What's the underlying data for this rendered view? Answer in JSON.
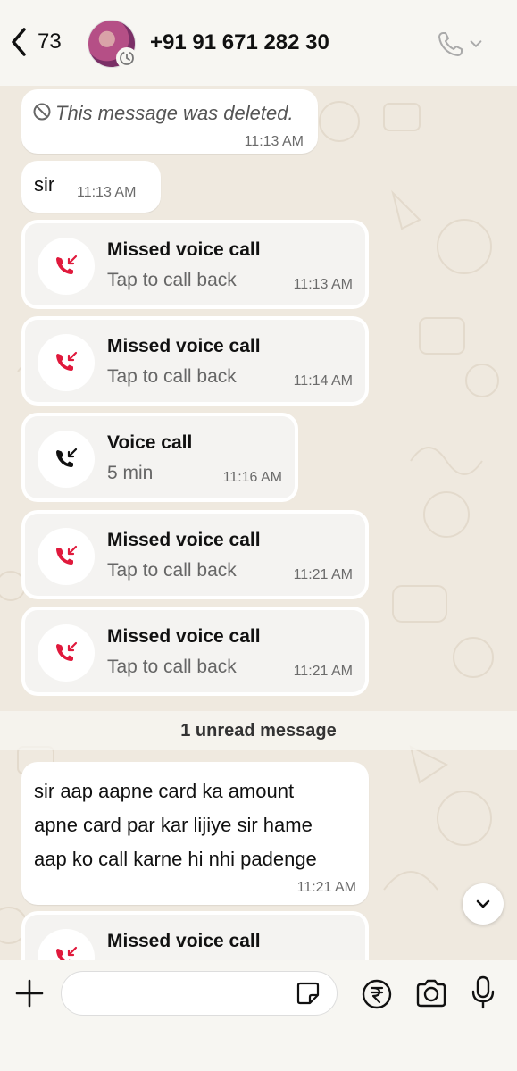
{
  "header": {
    "back_count": "73",
    "contact_name": "+91 91 671 282 30"
  },
  "messages": {
    "deleted": {
      "text": "This message was deleted.",
      "time": "11:13 AM"
    },
    "sir": {
      "text": "sir",
      "time": "11:13 AM"
    },
    "calls": [
      {
        "title": "Missed voice call",
        "subtitle": "Tap to call back",
        "time": "11:13 AM",
        "type": "missed"
      },
      {
        "title": "Missed voice call",
        "subtitle": "Tap to call back",
        "time": "11:14 AM",
        "type": "missed"
      },
      {
        "title": "Voice call",
        "subtitle": "5 min",
        "time": "11:16 AM",
        "type": "answered"
      },
      {
        "title": "Missed voice call",
        "subtitle": "Tap to call back",
        "time": "11:21 AM",
        "type": "missed"
      },
      {
        "title": "Missed voice call",
        "subtitle": "Tap to call back",
        "time": "11:21 AM",
        "type": "missed"
      }
    ],
    "unread_label": "1 unread message",
    "text_message": {
      "lines": [
        "sir aap  aapne card ka amount",
        "apne card par kar lijiye sir hame",
        "aap ko call karne hi nhi padenge"
      ],
      "time": "11:21 AM"
    },
    "last_call": {
      "title": "Missed voice call"
    }
  },
  "composer": {
    "placeholder": ""
  },
  "colors": {
    "missed": "#e0193c",
    "answered": "#111111",
    "background": "#efe9df"
  },
  "icons": [
    "back-chevron-icon",
    "call-icon",
    "chevron-down-icon",
    "missed-call-icon",
    "incoming-call-icon",
    "plus-icon",
    "sticker-icon",
    "rupee-icon",
    "camera-icon",
    "mic-icon",
    "deleted-icon"
  ]
}
